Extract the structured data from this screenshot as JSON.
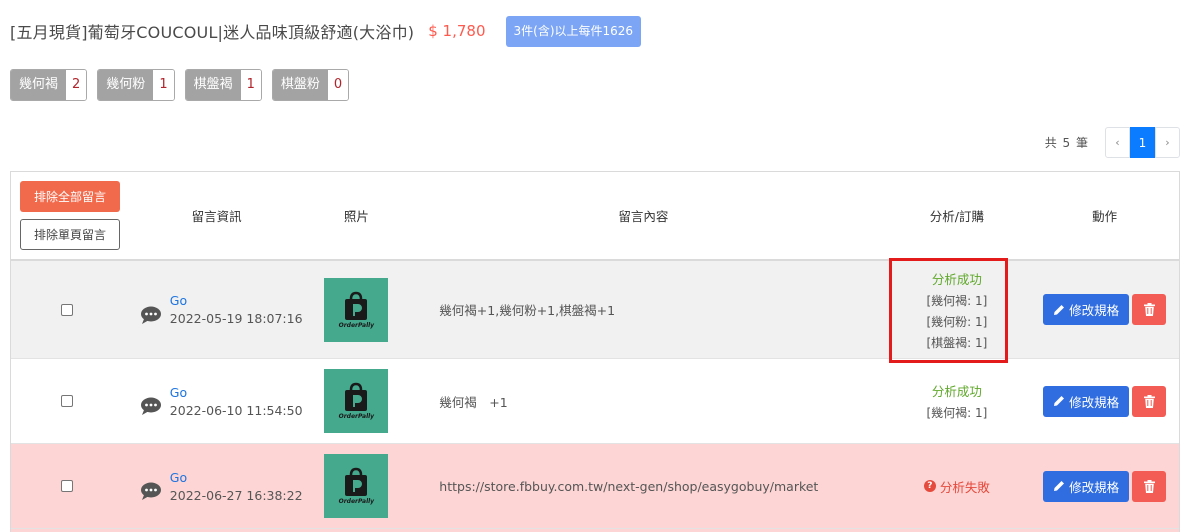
{
  "product": {
    "title": "[五月現貨]葡萄牙COUCOUL|迷人品味頂級舒適(大浴巾)",
    "price": "$ 1,780",
    "bulk_badge": "3件(含)以上每件1626"
  },
  "specs": [
    {
      "name": "幾何褐",
      "count": "2"
    },
    {
      "name": "幾何粉",
      "count": "1"
    },
    {
      "name": "棋盤褐",
      "count": "1"
    },
    {
      "name": "棋盤粉",
      "count": "0"
    }
  ],
  "pagination": {
    "total_label": "共 5 筆",
    "prev": "‹",
    "current": "1",
    "next": "›"
  },
  "table": {
    "exclude_all_label": "排除全部留言",
    "exclude_page_label": "排除單頁留言",
    "columns": {
      "info": "留言資訊",
      "photo": "照片",
      "content": "留言內容",
      "analysis": "分析/訂購",
      "actions": "動作"
    },
    "photo_label": "OrderPally",
    "edit_label": "修改規格",
    "rows": [
      {
        "link": "Go",
        "datetime": "2022-05-19 18:07:16",
        "content": "幾何褐+1,幾何粉+1,棋盤褐+1",
        "status": "分析成功",
        "lines": [
          "[幾何褐: 1]",
          "[幾何粉: 1]",
          "[棋盤褐: 1]"
        ]
      },
      {
        "link": "Go",
        "datetime": "2022-06-10 11:54:50",
        "content": "幾何褐　+1",
        "status": "分析成功",
        "lines": [
          "[幾何褐: 1]"
        ]
      },
      {
        "link": "Go",
        "datetime": "2022-06-27 16:38:22",
        "content": "https://store.fbbuy.com.tw/next-gen/shop/easygobuy/market",
        "status": "分析失敗",
        "lines": []
      }
    ]
  },
  "colors": {
    "price": "#ff5a4e",
    "badge": "#7ca6f5",
    "success": "#5fa82a",
    "fail": "#e54a3c",
    "highlight": "#e31b1b",
    "failed_row": "#fdd5d5"
  }
}
